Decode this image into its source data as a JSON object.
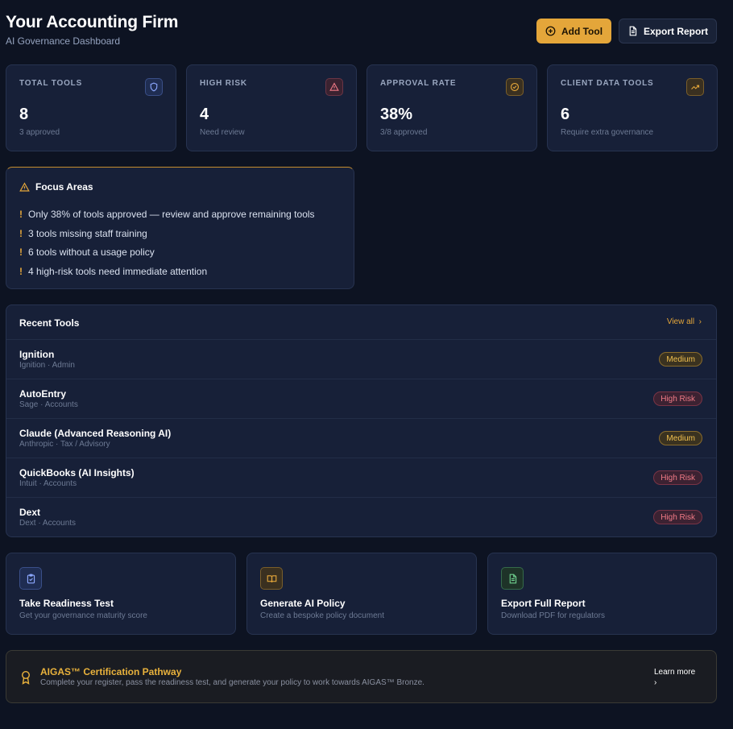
{
  "header": {
    "title": "Your Accounting Firm",
    "subtitle": "AI Governance Dashboard",
    "add_tool_label": "Add Tool",
    "export_report_label": "Export Report"
  },
  "stats": [
    {
      "label": "TOTAL TOOLS",
      "value": "8",
      "sub": "3 approved",
      "icon": "shield-icon"
    },
    {
      "label": "HIGH RISK",
      "value": "4",
      "sub": "Need review",
      "icon": "warning-triangle-icon"
    },
    {
      "label": "APPROVAL RATE",
      "value": "38%",
      "sub": "3/8 approved",
      "icon": "check-circle-icon"
    },
    {
      "label": "CLIENT DATA TOOLS",
      "value": "6",
      "sub": "Require extra governance",
      "icon": "trending-up-icon"
    }
  ],
  "focus": {
    "title": "Focus Areas",
    "marker": "!",
    "items": [
      "Only 38% of tools approved — review and approve remaining tools",
      "3 tools missing staff training",
      "6 tools without a usage policy",
      "4 high-risk tools need immediate attention"
    ]
  },
  "recent": {
    "title": "Recent Tools",
    "view_all": "View all",
    "rows": [
      {
        "name": "Ignition",
        "meta": "Ignition · Admin",
        "risk": "Medium"
      },
      {
        "name": "AutoEntry",
        "meta": "Sage · Accounts",
        "risk": "High Risk"
      },
      {
        "name": "Claude (Advanced Reasoning AI)",
        "meta": "Anthropic · Tax / Advisory",
        "risk": "Medium"
      },
      {
        "name": "QuickBooks (AI Insights)",
        "meta": "Intuit · Accounts",
        "risk": "High Risk"
      },
      {
        "name": "Dext",
        "meta": "Dext · Accounts",
        "risk": "High Risk"
      }
    ]
  },
  "actions": [
    {
      "title": "Take Readiness Test",
      "sub": "Get your governance maturity score",
      "icon": "clipboard-check-icon"
    },
    {
      "title": "Generate AI Policy",
      "sub": "Create a bespoke policy document",
      "icon": "book-open-icon"
    },
    {
      "title": "Export Full Report",
      "sub": "Download PDF for regulators",
      "icon": "file-text-icon"
    }
  ],
  "certification": {
    "title": "AIGAS™ Certification Pathway",
    "sub": "Complete your register, pass the readiness test, and generate your policy to work towards AIGAS™ Bronze.",
    "learn_more": "Learn more",
    "icon": "award-icon"
  },
  "colors": {
    "accent": "#e4a63a",
    "background": "#0d1322",
    "card": "#172038",
    "medium_badge": "#f0c04f",
    "high_badge": "#f07a86"
  }
}
